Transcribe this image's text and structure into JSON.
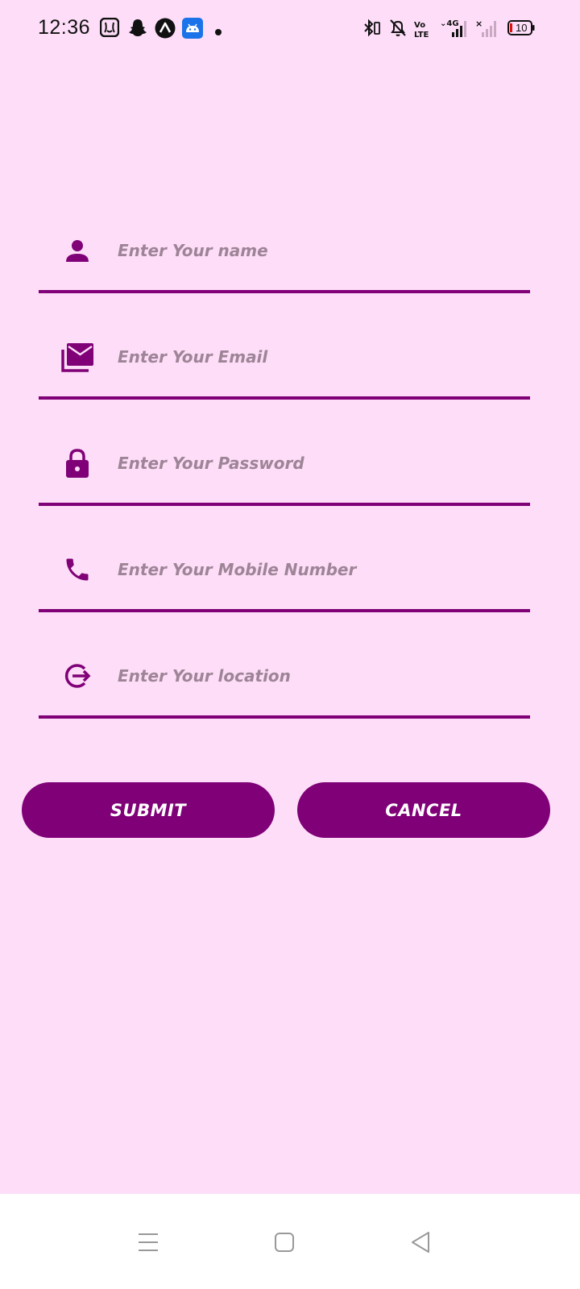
{
  "status_bar": {
    "time": "12:36",
    "battery": "10",
    "notification_icons": [
      "saavn-icon",
      "snapchat-icon",
      "arc-icon",
      "android-icon",
      "dot-icon"
    ],
    "system_icons": [
      "bluetooth-icon",
      "bell-off-icon",
      "volte-icon",
      "signal-4g-icon",
      "signal-no-icon",
      "battery-icon"
    ]
  },
  "form": {
    "fields": [
      {
        "icon": "person-icon",
        "placeholder": "Enter Your name"
      },
      {
        "icon": "email-icon",
        "placeholder": "Enter Your Email"
      },
      {
        "icon": "lock-icon",
        "placeholder": "Enter Your Password"
      },
      {
        "icon": "phone-icon",
        "placeholder": "Enter Your Mobile Number"
      },
      {
        "icon": "location-icon",
        "placeholder": "Enter Your location"
      }
    ],
    "submit_label": "SUBMIT",
    "cancel_label": "CANCEL"
  },
  "colors": {
    "background": "#fdddf7",
    "accent": "#7f0077",
    "placeholder": "#9e8497"
  },
  "nav": [
    "menu-icon",
    "home-icon",
    "back-icon"
  ]
}
